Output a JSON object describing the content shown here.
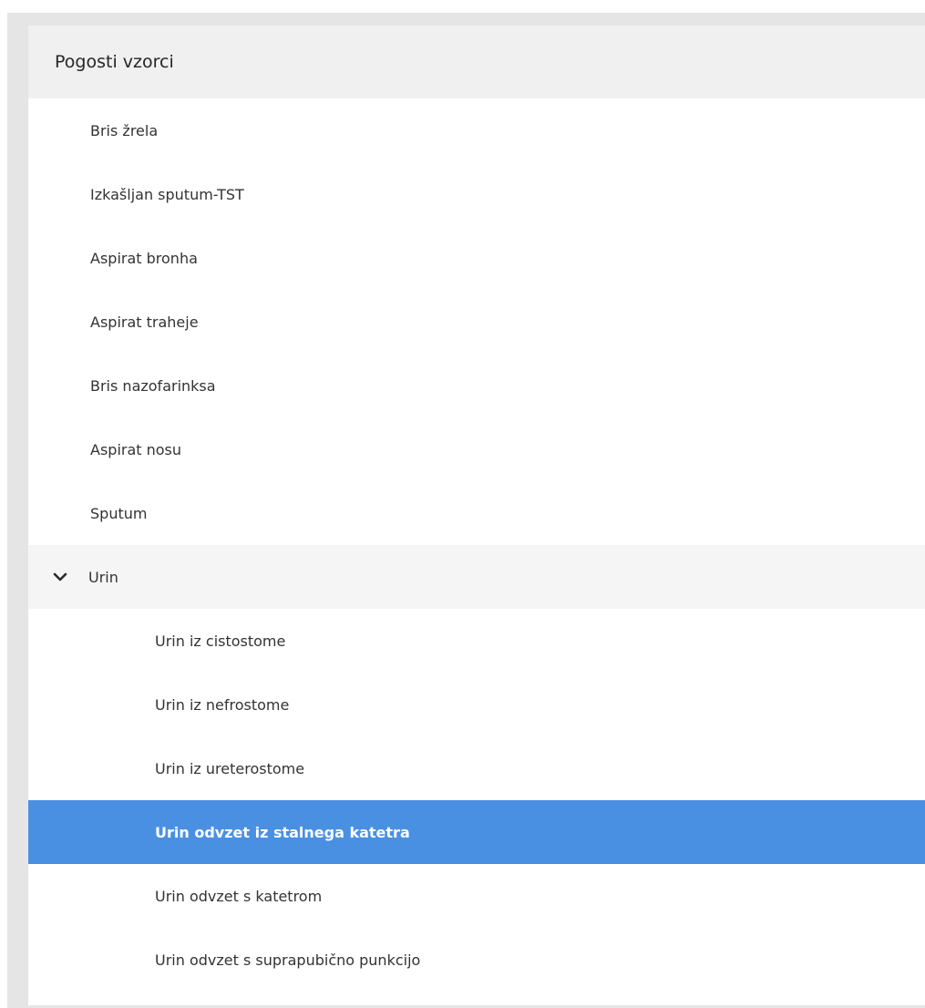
{
  "panel": {
    "title": "Pogosti vzorci"
  },
  "items": [
    {
      "label": "Bris žrela"
    },
    {
      "label": "Izkašljan sputum-TST"
    },
    {
      "label": "Aspirat bronha"
    },
    {
      "label": "Aspirat traheje"
    },
    {
      "label": "Bris nazofarinksa"
    },
    {
      "label": "Aspirat nosu"
    },
    {
      "label": "Sputum"
    }
  ],
  "group": {
    "label": "Urin",
    "expanded": true,
    "icon": "chevron-down-icon",
    "children": [
      {
        "label": "Urin iz cistostome",
        "selected": false
      },
      {
        "label": "Urin iz nefrostome",
        "selected": false
      },
      {
        "label": "Urin iz ureterostome",
        "selected": false
      },
      {
        "label": "Urin odvzet iz stalnega katetra",
        "selected": true
      },
      {
        "label": "Urin odvzet s katetrom",
        "selected": false
      },
      {
        "label": "Urin odvzet s suprapubično punkcijo",
        "selected": false
      }
    ]
  },
  "colors": {
    "selected_bg": "#4a90e2",
    "header_bg": "#f0f0f0",
    "group_bg": "#f5f5f5"
  }
}
